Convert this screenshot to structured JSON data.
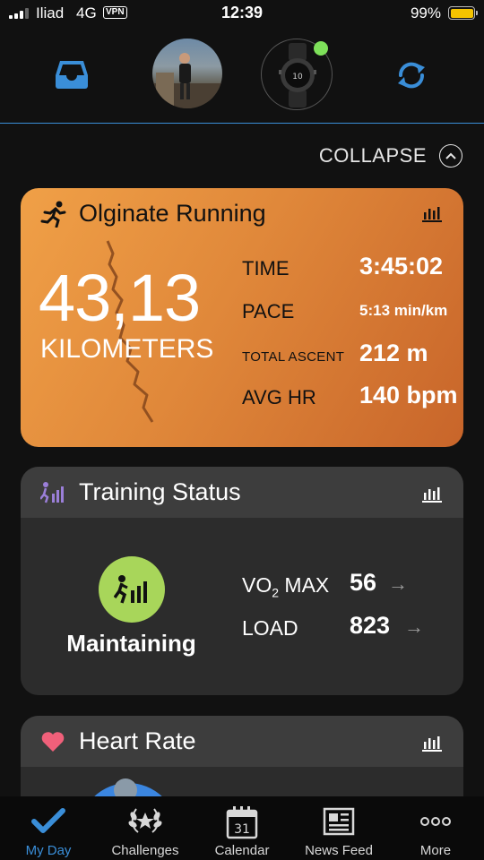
{
  "status_bar": {
    "carrier": "Iliad",
    "network": "4G",
    "vpn": "VPN",
    "time": "12:39",
    "battery": "99%"
  },
  "top_bar": {
    "icons": [
      "inbox-icon",
      "avatar",
      "watch-device",
      "sync-icon"
    ],
    "device_connected_color": "#7ee05a"
  },
  "collapse": {
    "label": "COLLAPSE"
  },
  "run_card": {
    "title": "Olginate Running",
    "distance": "43,13",
    "distance_unit": "KILOMETERS",
    "stats": [
      {
        "label": "TIME",
        "value": "3:45:02"
      },
      {
        "label": "PACE",
        "value": "5:13 min/km"
      },
      {
        "label": "TOTAL ASCENT",
        "value": "212 m"
      },
      {
        "label": "AVG HR",
        "value": "140 bpm"
      }
    ],
    "gradient_colors": [
      "#f0a047",
      "#c8652a"
    ]
  },
  "training_card": {
    "title": "Training Status",
    "status": "Maintaining",
    "status_color": "#a8d65a",
    "vo2_label_main": "VO",
    "vo2_label_sub": "2",
    "vo2_label_rest": " MAX",
    "vo2_value": "56",
    "load_label": "LOAD",
    "load_value": "823"
  },
  "heart_card": {
    "title": "Heart Rate",
    "icon_color": "#f0607a"
  },
  "tabs": [
    {
      "label": "My Day",
      "icon": "checkmark-icon",
      "active": true
    },
    {
      "label": "Challenges",
      "icon": "laurel-icon",
      "active": false
    },
    {
      "label": "Calendar",
      "icon": "calendar-icon",
      "day": "31",
      "active": false
    },
    {
      "label": "News Feed",
      "icon": "newspaper-icon",
      "active": false
    },
    {
      "label": "More",
      "icon": "more-icon",
      "active": false
    }
  ],
  "accent_color": "#3a8ed8"
}
